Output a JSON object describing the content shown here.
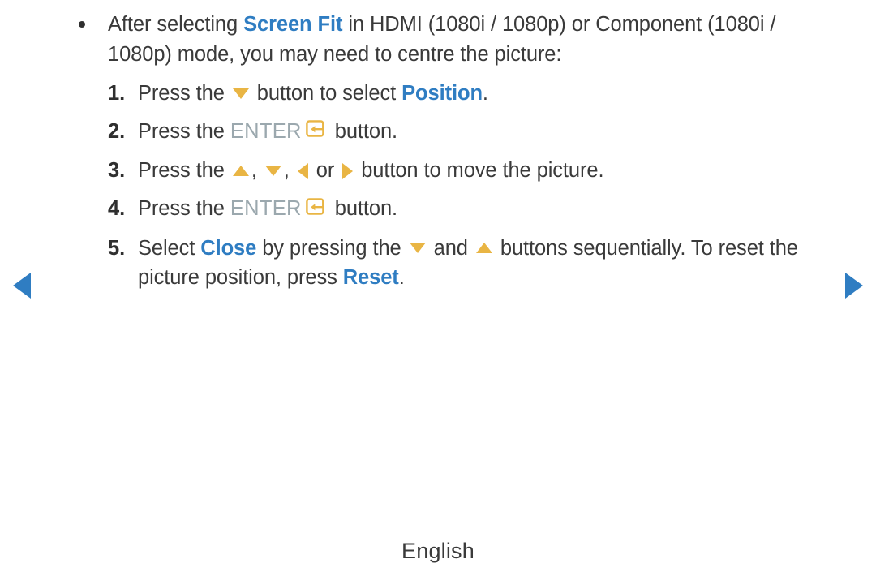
{
  "page": {
    "background_color": "#ffffff",
    "text_color": "#3a3a3a",
    "accent_blue": "#2f7dc2",
    "accent_gold": "#e9b544",
    "enter_label_color": "#9ba8ae",
    "language_footer": "English"
  },
  "bullet": {
    "marker": "bullet-dot",
    "text_1": "After selecting ",
    "highlight_1": "Screen Fit",
    "text_2": " in HDMI (1080i / 1080p) or Component (1080i / 1080p) mode, you may need to centre the picture:"
  },
  "steps": [
    {
      "number": "1.",
      "parts": {
        "a": "Press the ",
        "icon": "arrow-down-icon",
        "b": " button to select ",
        "highlight": "Position",
        "c": "."
      }
    },
    {
      "number": "2.",
      "parts": {
        "a": "Press the ",
        "enter_word": "ENTER",
        "icon": "enter-key-icon",
        "b": " button."
      }
    },
    {
      "number": "3.",
      "parts": {
        "a": "Press the ",
        "icon_up": "arrow-up-icon",
        "sep1": ", ",
        "icon_down": "arrow-down-icon",
        "sep2": ", ",
        "icon_left": "arrow-left-icon",
        "or": " or ",
        "icon_right": "arrow-right-icon",
        "b": " button to move the picture."
      }
    },
    {
      "number": "4.",
      "parts": {
        "a": "Press the ",
        "enter_word": "ENTER",
        "icon": "enter-key-icon",
        "b": " button."
      }
    },
    {
      "number": "5.",
      "parts": {
        "a": "Select ",
        "highlight_1": "Close",
        "b": " by pressing the ",
        "icon_down": "arrow-down-icon",
        "c": " and ",
        "icon_up": "arrow-up-icon",
        "d": " buttons sequentially. To reset the picture position, press ",
        "highlight_2": "Reset",
        "e": "."
      }
    }
  ],
  "navigation": {
    "prev_label": "previous-page",
    "next_label": "next-page",
    "prev_icon": "triangle-left-icon",
    "next_icon": "triangle-right-icon"
  }
}
